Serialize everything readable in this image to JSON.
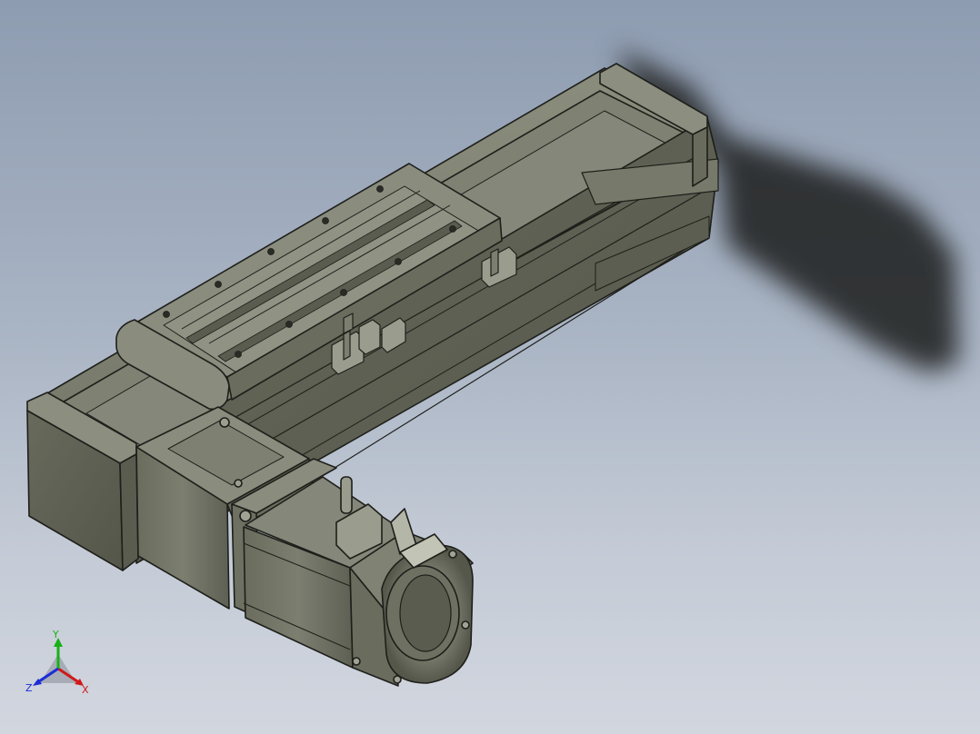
{
  "viewport": {
    "background_top": "#8e9cb1",
    "background_bottom": "#d2d6df",
    "model_color": "#6f7163",
    "model_edge_color": "#1e1f1a"
  },
  "triad": {
    "x_label": "X",
    "y_label": "Y",
    "z_label": "Z",
    "x_color": "#d01818",
    "y_color": "#18b018",
    "z_color": "#1c2cd8"
  }
}
